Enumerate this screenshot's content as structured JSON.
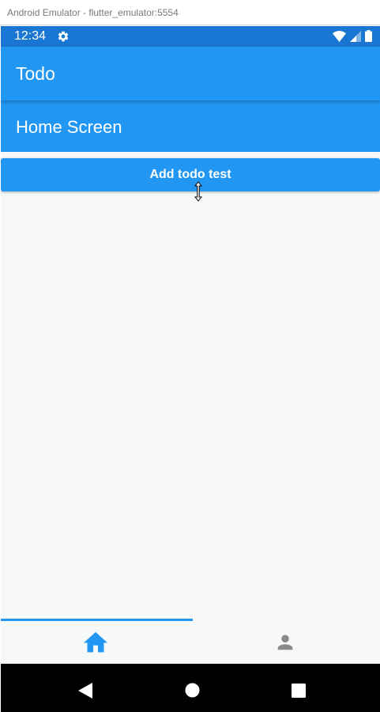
{
  "window": {
    "title": "Android Emulator - flutter_emulator:5554"
  },
  "status_bar": {
    "time": "12:34"
  },
  "app_bar": {
    "title": "Todo"
  },
  "home": {
    "title": "Home Screen"
  },
  "actions": {
    "add_todo_label": "Add todo test"
  },
  "bottom_nav": {
    "items": [
      {
        "icon": "home-icon",
        "selected": true
      },
      {
        "icon": "person-icon",
        "selected": false
      }
    ]
  },
  "colors": {
    "primary": "#2196f3",
    "primary_dark": "#1976d2",
    "inactive_icon": "#8a8a8a",
    "background": "#f7f9f9"
  }
}
